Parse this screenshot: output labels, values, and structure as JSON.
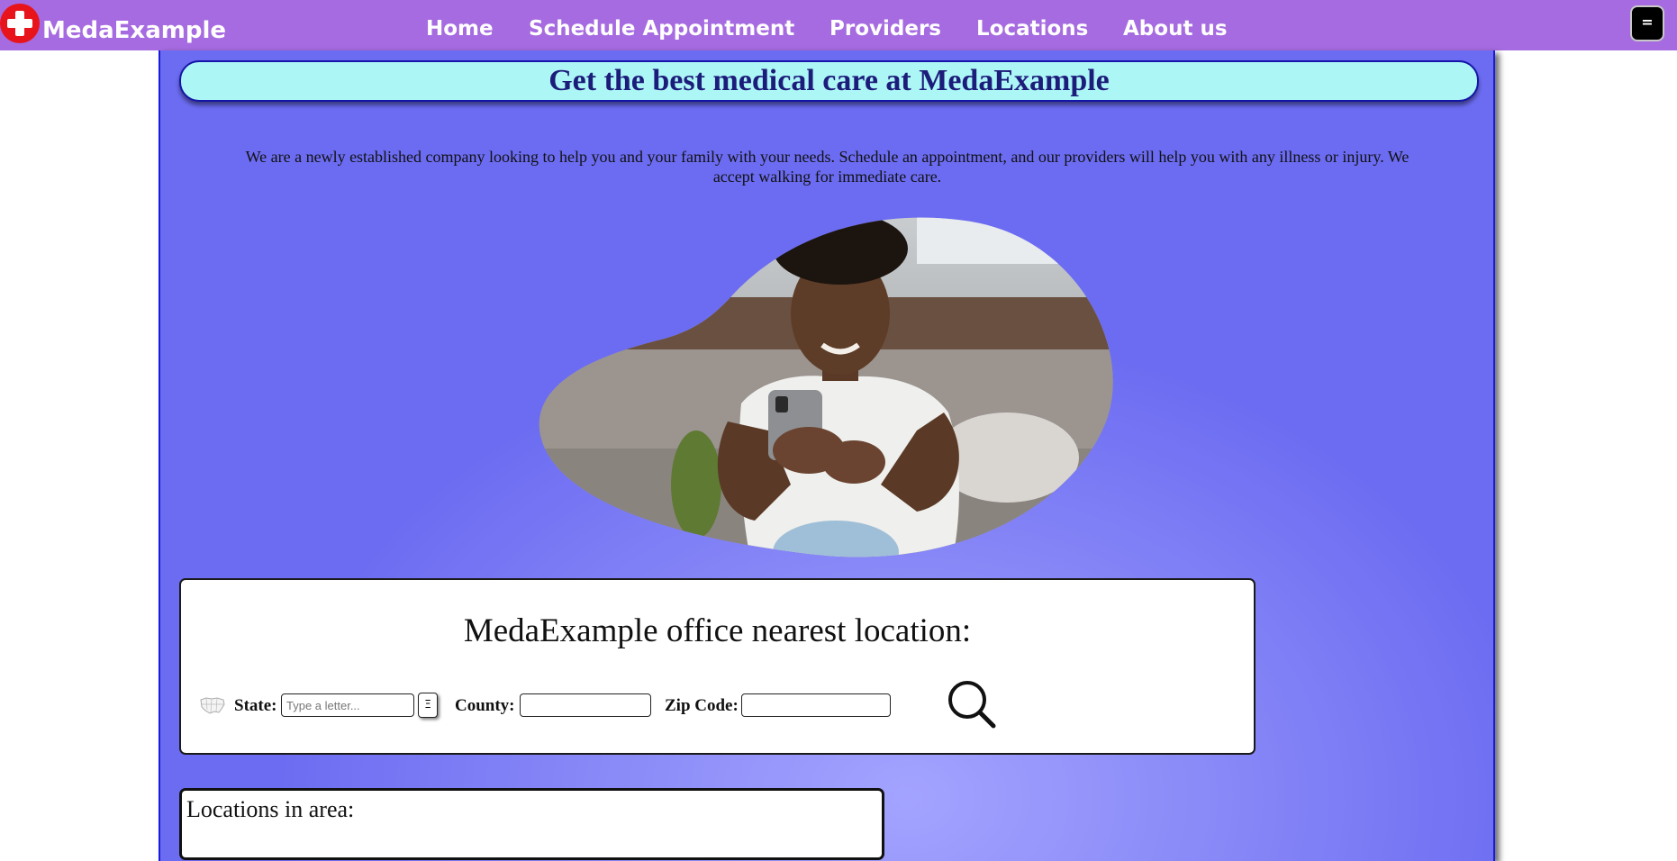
{
  "brand": {
    "name": "MedaExample"
  },
  "nav": {
    "links": [
      "Home",
      "Schedule Appointment",
      "Providers",
      "Locations",
      "About us"
    ],
    "menu_label": "="
  },
  "hero": {
    "headline": "Get the best medical care at MedaExample",
    "intro": "We are a newly established company looking to help you and your family with your needs. Schedule an appointment, and our providers will help you with any illness or injury. We accept walking for immediate care."
  },
  "search": {
    "title": "MedaExample office nearest location:",
    "state_label": "State:",
    "state_placeholder": "Type a letter...",
    "state_value": "",
    "list_button_label": "Ξ",
    "county_label": "County:",
    "county_value": "",
    "zip_label": "Zip Code:",
    "zip_value": ""
  },
  "locations": {
    "title": "Locations in area:"
  },
  "colors": {
    "navbar": "#a66be0",
    "panel": "#7a7af5",
    "headline_bg": "#adf6f6",
    "headline_text": "#1c1c7a",
    "logo_red": "#e8141c"
  },
  "icons": {
    "logo": "medical-cross-icon",
    "map": "usa-map-icon",
    "search": "magnifier-icon",
    "menu": "hamburger-icon"
  }
}
